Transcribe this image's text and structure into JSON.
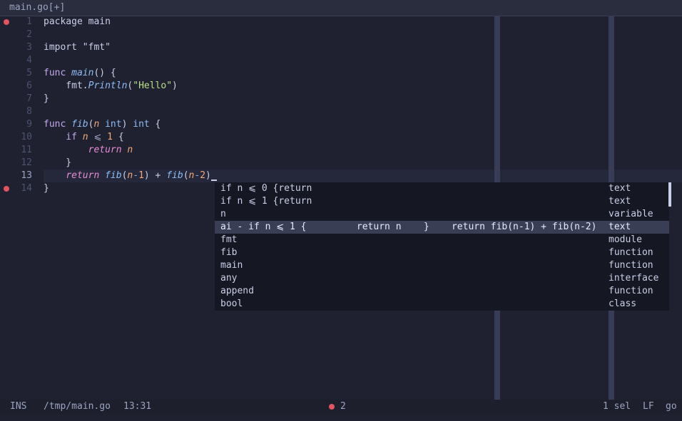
{
  "tab": {
    "title": "main.go[+]"
  },
  "colors": {
    "background": "#1f2130",
    "keyword": "#c3a8ef",
    "type": "#8fbcf5",
    "string": "#b9df8a",
    "number": "#f0a97a",
    "return_keyword": "#e78cd4",
    "breakpoint": "#e05561"
  },
  "editor": {
    "line_numbers": [
      "1",
      "2",
      "3",
      "4",
      "5",
      "6",
      "7",
      "8",
      "9",
      "10",
      "11",
      "12",
      "13",
      "14"
    ],
    "breakpoint_lines": [
      1,
      14
    ],
    "current_line": 13,
    "lines": [
      [
        {
          "t": "package",
          "c": "pl"
        },
        {
          "t": " main",
          "c": "pl"
        }
      ],
      [],
      [
        {
          "t": "import",
          "c": "pl"
        },
        {
          "t": " ",
          "c": "pl"
        },
        {
          "t": "\"fmt\"",
          "c": "pl"
        }
      ],
      [],
      [
        {
          "t": "func",
          "c": "kw"
        },
        {
          "t": " ",
          "c": "pl"
        },
        {
          "t": "main",
          "c": "fn"
        },
        {
          "t": "() {",
          "c": "pl"
        }
      ],
      [
        {
          "t": "    fmt.",
          "c": "pl"
        },
        {
          "t": "Println",
          "c": "fn"
        },
        {
          "t": "(",
          "c": "pl"
        },
        {
          "t": "\"Hello\"",
          "c": "str"
        },
        {
          "t": ")",
          "c": "pl"
        }
      ],
      [
        {
          "t": "}",
          "c": "pl"
        }
      ],
      [],
      [
        {
          "t": "func",
          "c": "kw"
        },
        {
          "t": " ",
          "c": "pl"
        },
        {
          "t": "fib",
          "c": "fn"
        },
        {
          "t": "(",
          "c": "pl"
        },
        {
          "t": "n",
          "c": "var"
        },
        {
          "t": " ",
          "c": "pl"
        },
        {
          "t": "int",
          "c": "ty"
        },
        {
          "t": ") ",
          "c": "pl"
        },
        {
          "t": "int",
          "c": "ty"
        },
        {
          "t": " {",
          "c": "pl"
        }
      ],
      [
        {
          "t": "    ",
          "c": "pl"
        },
        {
          "t": "if",
          "c": "kw"
        },
        {
          "t": " ",
          "c": "pl"
        },
        {
          "t": "n",
          "c": "var"
        },
        {
          "t": " ⩽ ",
          "c": "op"
        },
        {
          "t": "1",
          "c": "num"
        },
        {
          "t": " {",
          "c": "pl"
        }
      ],
      [
        {
          "t": "        ",
          "c": "pl"
        },
        {
          "t": "return",
          "c": "kwi"
        },
        {
          "t": " ",
          "c": "pl"
        },
        {
          "t": "n",
          "c": "var"
        }
      ],
      [
        {
          "t": "    }",
          "c": "pl"
        }
      ],
      [
        {
          "t": "    ",
          "c": "pl"
        },
        {
          "t": "return",
          "c": "kwi"
        },
        {
          "t": " ",
          "c": "pl"
        },
        {
          "t": "fib",
          "c": "fn"
        },
        {
          "t": "(",
          "c": "pl"
        },
        {
          "t": "n",
          "c": "var"
        },
        {
          "t": "-",
          "c": "op"
        },
        {
          "t": "1",
          "c": "num"
        },
        {
          "t": ") + ",
          "c": "pl"
        },
        {
          "t": "fib",
          "c": "fn"
        },
        {
          "t": "(",
          "c": "pl"
        },
        {
          "t": "n",
          "c": "var"
        },
        {
          "t": "-",
          "c": "op"
        },
        {
          "t": "2",
          "c": "num"
        },
        {
          "t": ")",
          "c": "pl"
        }
      ],
      [
        {
          "t": "}",
          "c": "pl"
        }
      ]
    ]
  },
  "completion_menu": {
    "items": [
      {
        "label": "if n ⩽ 0 {return",
        "kind": "text"
      },
      {
        "label": "if n ⩽ 1 {return",
        "kind": "text"
      },
      {
        "label": "n",
        "kind": "variable"
      },
      {
        "label": "ai - if n ⩽ 1 {         return n    }    return fib(n-1) + fib(n-2)",
        "kind": "text",
        "selected": true
      },
      {
        "label": "fmt",
        "kind": "module"
      },
      {
        "label": "fib",
        "kind": "function"
      },
      {
        "label": "main",
        "kind": "function"
      },
      {
        "label": "any",
        "kind": "interface"
      },
      {
        "label": "append",
        "kind": "function"
      },
      {
        "label": "bool",
        "kind": "class"
      }
    ]
  },
  "statusline": {
    "mode": "INS",
    "path": "/tmp/main.go",
    "position": "13:31",
    "diagnostics_count": "2",
    "selection": "1 sel",
    "line_ending": "LF",
    "language": "go"
  }
}
